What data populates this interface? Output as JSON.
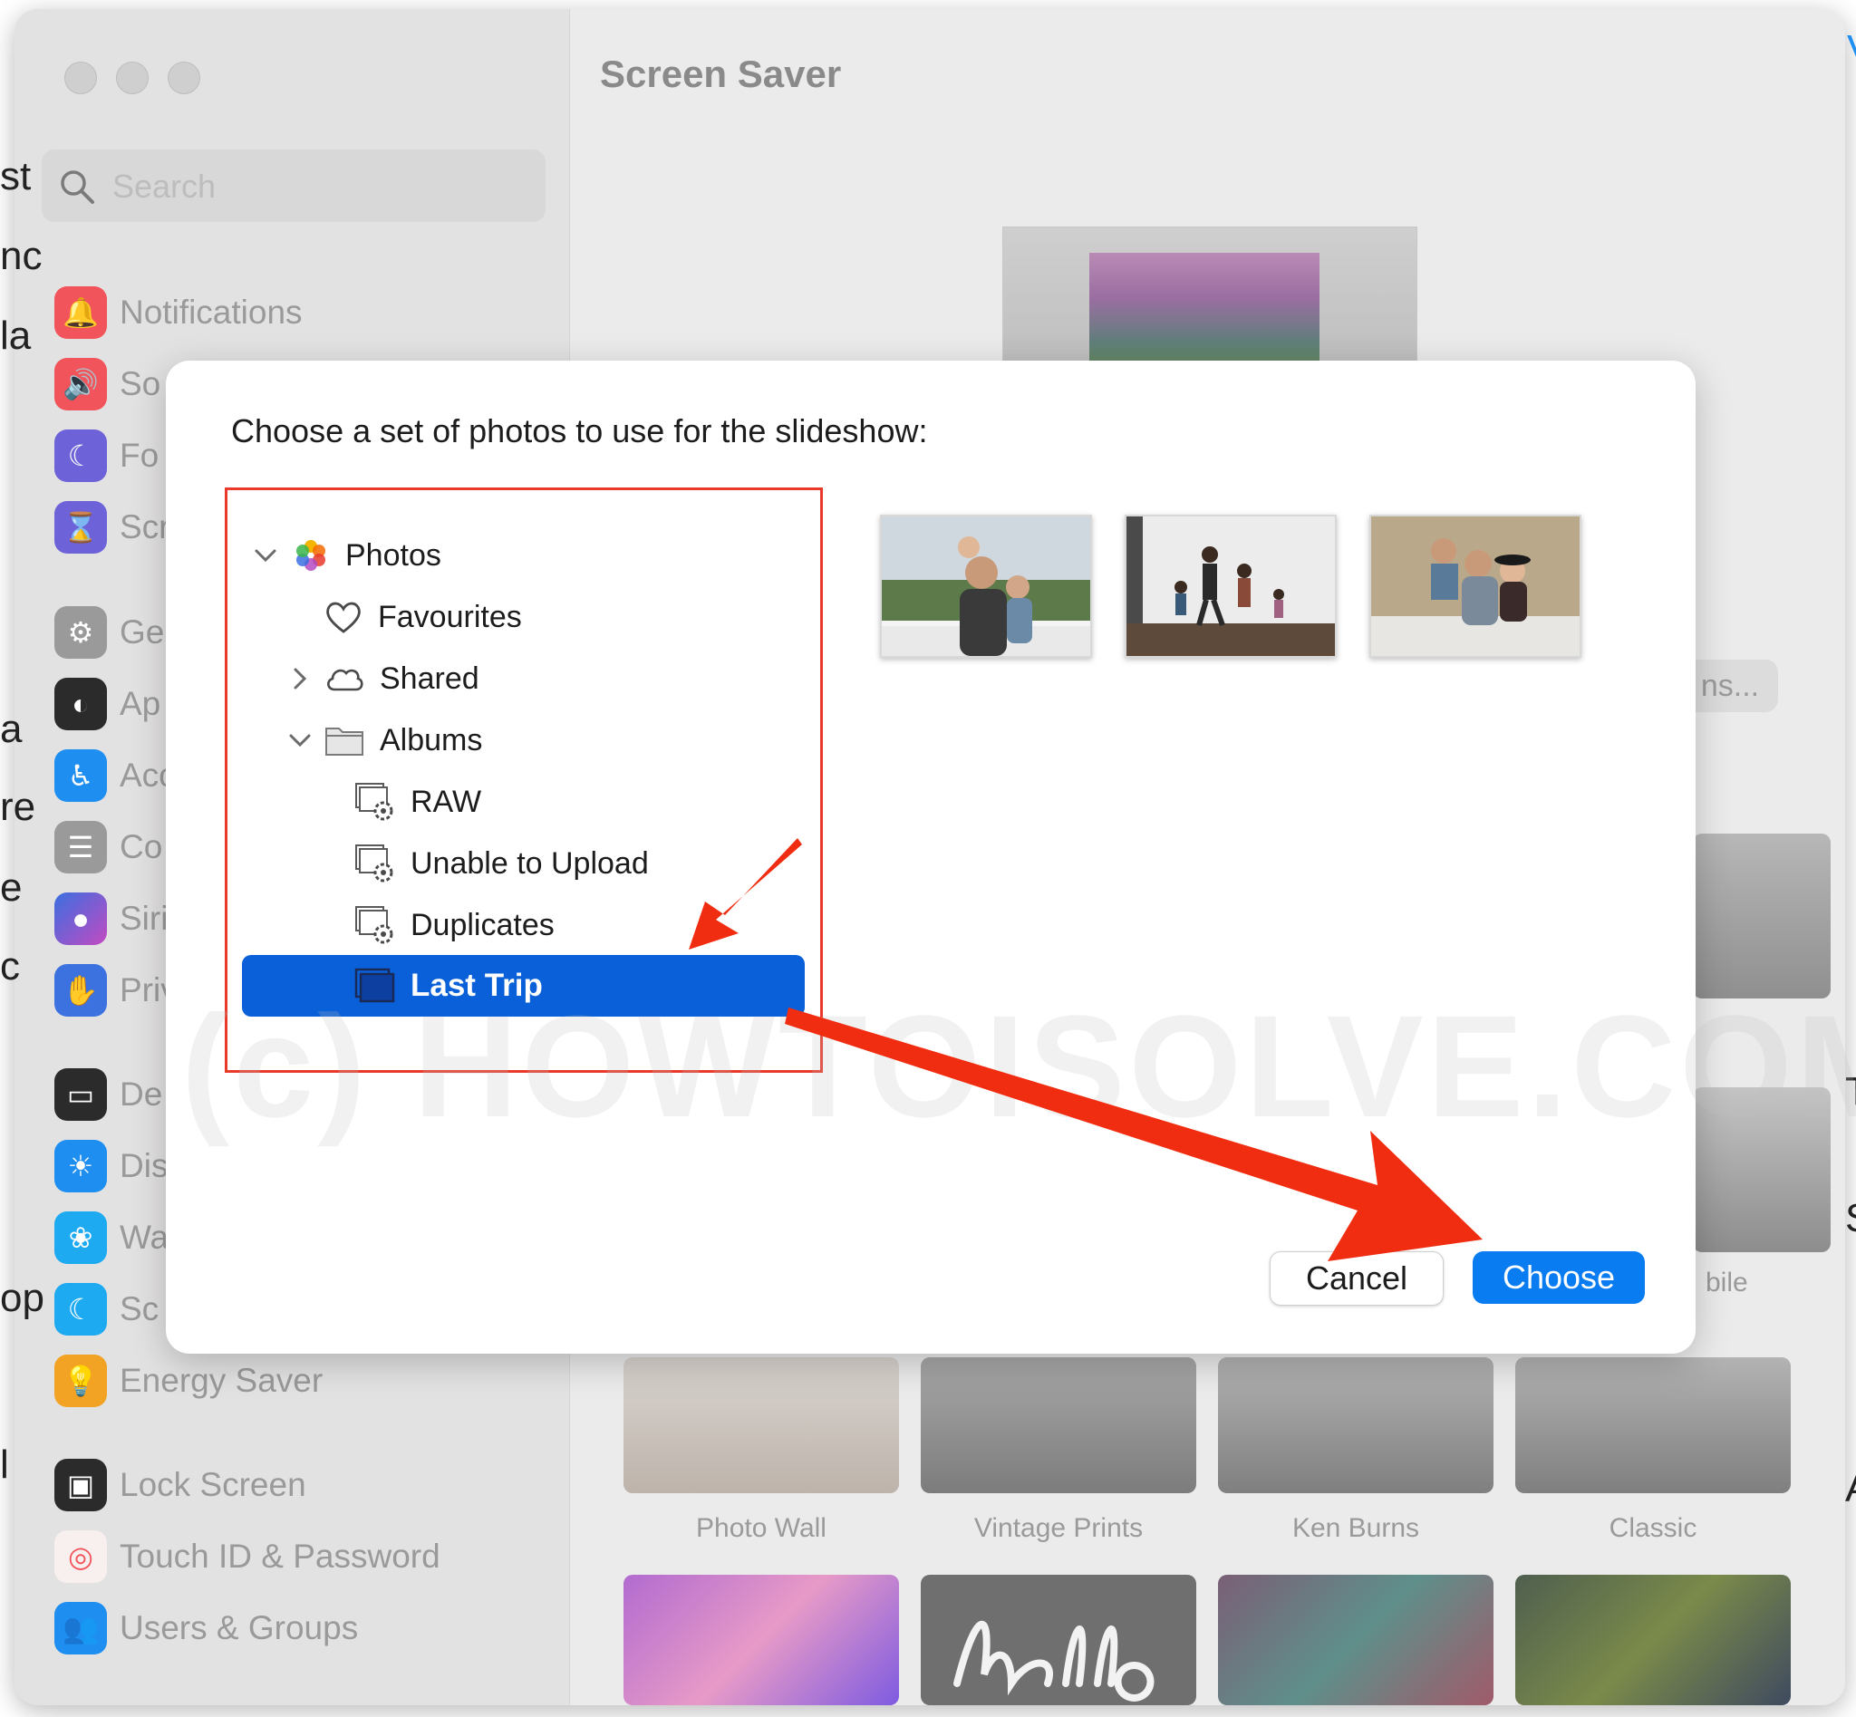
{
  "window": {
    "title": "Screen Saver"
  },
  "sidebar": {
    "search_placeholder": "Search",
    "items": [
      {
        "label": "Notifications",
        "icon": "bell-icon",
        "color": "#f2545b"
      },
      {
        "label": "So",
        "icon": "speaker-icon",
        "color": "#f2545b"
      },
      {
        "label": "Fo",
        "icon": "moon-icon",
        "color": "#6e62d8"
      },
      {
        "label": "Scr",
        "icon": "hourglass-icon",
        "color": "#6e62d8"
      },
      {
        "label": "Ge",
        "icon": "gear-icon",
        "color": "#9a9a9a"
      },
      {
        "label": "Ap",
        "icon": "appearance-icon",
        "color": "#2b2b2b"
      },
      {
        "label": "Acc",
        "icon": "accessibility-icon",
        "color": "#1e8ef0"
      },
      {
        "label": "Co",
        "icon": "toggle-icon",
        "color": "#9a9a9a"
      },
      {
        "label": "Siri",
        "icon": "siri-icon",
        "color": "#7b4ec2"
      },
      {
        "label": "Priv",
        "icon": "hand-icon",
        "color": "#3b72e0"
      },
      {
        "label": "De",
        "icon": "desktop-icon",
        "color": "#2b2b2b"
      },
      {
        "label": "Dis",
        "icon": "sun-icon",
        "color": "#1e8ef0"
      },
      {
        "label": "Wa",
        "icon": "flower-icon",
        "color": "#1eaaf0"
      },
      {
        "label": "Sc",
        "icon": "moon-icon",
        "color": "#1eaaf0"
      },
      {
        "label": "Energy Saver",
        "icon": "bulb-icon",
        "color": "#f2a324"
      },
      {
        "label": "Lock Screen",
        "icon": "lock-screen-icon",
        "color": "#2b2b2b"
      },
      {
        "label": "Touch ID & Password",
        "icon": "fingerprint-icon",
        "color": "#f2545b"
      },
      {
        "label": "Users & Groups",
        "icon": "users-icon",
        "color": "#1e8ef0"
      }
    ]
  },
  "content": {
    "options_button_partial": "ns...",
    "mobile_partial": "bile",
    "styles": [
      "Photo Wall",
      "Vintage Prints",
      "Ken Burns",
      "Classic"
    ]
  },
  "dialog": {
    "title": "Choose a set of photos to use for the slideshow:",
    "tree": {
      "photos": "Photos",
      "favourites": "Favourites",
      "shared": "Shared",
      "albums": "Albums",
      "raw": "RAW",
      "unable": "Unable to Upload",
      "duplicates": "Duplicates",
      "last_trip": "Last Trip"
    },
    "cancel_label": "Cancel",
    "choose_label": "Choose"
  },
  "watermark": "(c) HOWTOISOLVE.COM",
  "edge_left": [
    "st",
    "nc",
    "la",
    "a",
    "re",
    "e",
    "c",
    "op",
    "l"
  ],
  "edge_right": [
    "V",
    "T",
    "S",
    "A"
  ],
  "colors": {
    "accent": "#0a60d8",
    "button": "#0a7cf2",
    "annotation": "#f02d10"
  }
}
